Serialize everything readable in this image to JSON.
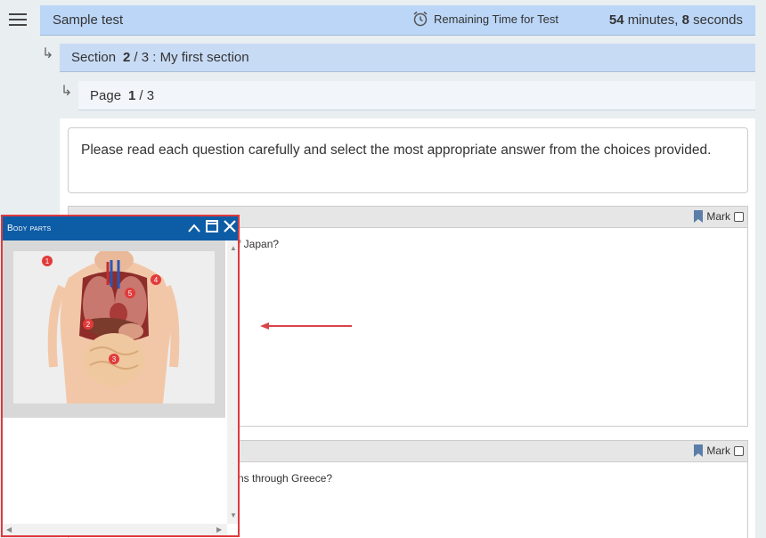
{
  "header": {
    "test_title": "Sample test",
    "timer_label": "Remaining Time for Test",
    "minutes": "54",
    "minutes_unit": "minutes,",
    "seconds": "8",
    "seconds_unit": "seconds"
  },
  "section": {
    "label": "Section",
    "current": "2",
    "rest": "/ 3 : My first section"
  },
  "page": {
    "label": "Page",
    "current": "1",
    "rest": "/ 3"
  },
  "instructions": "Please read each question carefully and select the most appropriate answer from the choices provided.",
  "questions": [
    {
      "mark_label": "Mark",
      "visible_text": "f Japan?"
    },
    {
      "mark_label": "Mark",
      "visible_text": "ns through Greece?"
    }
  ],
  "popup": {
    "title": "Body parts",
    "markers": [
      "1",
      "2",
      "3",
      "4",
      "5"
    ]
  },
  "colors": {
    "header_bg": "#bcd6f7",
    "popup_header": "#0d5ca6",
    "popup_border": "#e0393e",
    "marker": "#e23b3b"
  }
}
